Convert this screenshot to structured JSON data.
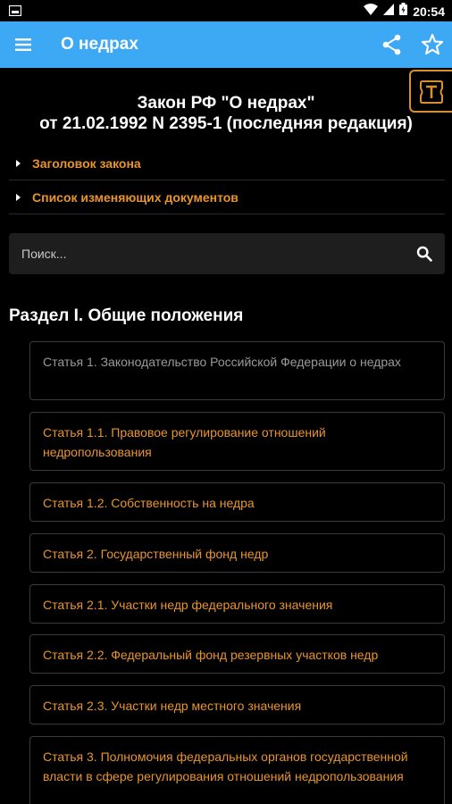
{
  "statusbar": {
    "time": "20:54"
  },
  "appbar": {
    "title": "О недрах"
  },
  "law": {
    "title_line1": "Закон РФ \"О недрах\"",
    "title_line2": "от 21.02.1992 N 2395-1 (последняя редакция)"
  },
  "expanders": [
    {
      "label": "Заголовок закона"
    },
    {
      "label": "Список изменяющих документов"
    }
  ],
  "search": {
    "placeholder": "Поиск..."
  },
  "section": {
    "title": "Раздел I. Общие положения"
  },
  "articles": [
    {
      "label": "Статья 1. Законодательство Российской Федерации о недрах",
      "visited": true
    },
    {
      "label": "Статья 1.1. Правовое регулирование отношений недропользования"
    },
    {
      "label": "Статья 1.2. Собственность на недра"
    },
    {
      "label": "Статья 2. Государственный фонд недр"
    },
    {
      "label": "Статья 2.1. Участки недр федерального значения"
    },
    {
      "label": "Статья 2.2. Федеральный фонд резервных участков недр"
    },
    {
      "label": "Статья 2.3. Участки недр местного значения"
    },
    {
      "label": "Статья 3. Полномочия федеральных органов государственной власти в сфере регулирования отношений недропользования"
    }
  ],
  "colors": {
    "appbar": "#3da9f4",
    "accent": "#e8942e",
    "visited": "#9a9a9a",
    "background": "#000000"
  }
}
